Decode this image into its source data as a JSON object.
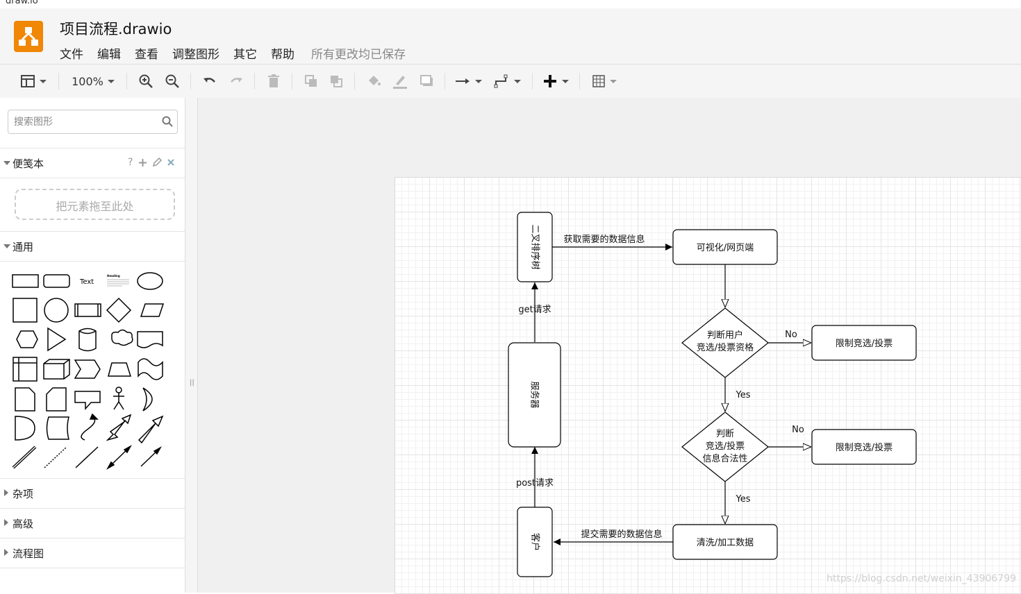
{
  "browser": {
    "tab_title": "draw.io"
  },
  "app": {
    "file_title": "项目流程.drawio",
    "save_status": "所有更改均已保存",
    "brand_color": "#f08705"
  },
  "menu": [
    "文件",
    "编辑",
    "查看",
    "调整图形",
    "其它",
    "帮助"
  ],
  "toolbar": {
    "zoom": "100%",
    "icons": [
      "format-panel-icon",
      "zoom-in-icon",
      "zoom-out-icon",
      "undo-icon",
      "redo-icon",
      "delete-icon",
      "to-front-icon",
      "to-back-icon",
      "fill-color-icon",
      "line-color-icon",
      "shadow-icon",
      "connection-icon",
      "waypoints-icon",
      "insert-icon",
      "table-icon"
    ]
  },
  "sidebar": {
    "search_placeholder": "搜索图形",
    "scratchpad": {
      "title": "便笺本",
      "help": "?",
      "drop_text": "把元素拖至此处"
    },
    "general": {
      "title": "通用",
      "text_shape": "Text",
      "heading_shape": "Heading"
    },
    "sections": [
      "杂项",
      "高级",
      "流程图"
    ]
  },
  "diagram": {
    "nodes": {
      "tree": "二叉排序树",
      "visual": "可视化/网页端",
      "judge1_l1": "判断用户",
      "judge1_l2": "竞选/投票资格",
      "limit1": "限制竞选/投票",
      "server": "服务器",
      "judge2_l1": "判断",
      "judge2_l2": "竞选/投票",
      "judge2_l3": "信息合法性",
      "limit2": "限制竞选/投票",
      "client": "客户",
      "clean": "清洗/加工数据"
    },
    "edges": {
      "fetch": "获取需要的数据信息",
      "get": "get请求",
      "post": "post请求",
      "submit": "提交需要的数据信息",
      "no1": "No",
      "yes1": "Yes",
      "no2": "No",
      "yes2": "Yes"
    }
  },
  "watermark": "https://blog.csdn.net/weixin_43906799"
}
